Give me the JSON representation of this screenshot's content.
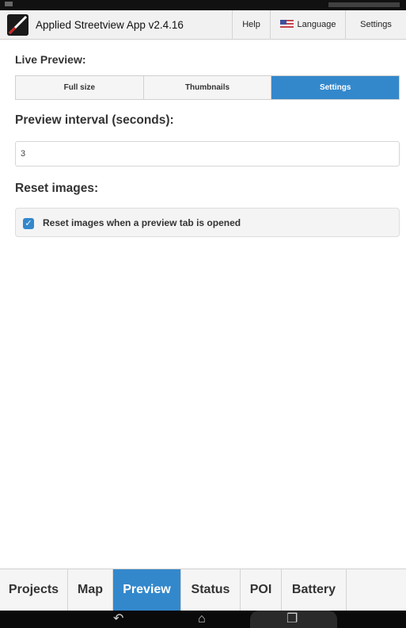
{
  "header": {
    "app_title": "Applied Streetview App v2.4.16",
    "help_label": "Help",
    "language_label": "Language",
    "settings_label": "Settings"
  },
  "live_preview": {
    "label": "Live Preview:",
    "tabs": [
      {
        "label": "Full size",
        "active": false
      },
      {
        "label": "Thumbnails",
        "active": false
      },
      {
        "label": "Settings",
        "active": true
      }
    ]
  },
  "preview_interval": {
    "label": "Preview interval (seconds):",
    "value": "3"
  },
  "reset_images": {
    "label": "Reset images:",
    "checkbox_label": "Reset images when a preview tab is opened",
    "checked": true
  },
  "bottom_nav": {
    "tabs": [
      {
        "label": "Projects",
        "active": false
      },
      {
        "label": "Map",
        "active": false
      },
      {
        "label": "Preview",
        "active": true
      },
      {
        "label": "Status",
        "active": false
      },
      {
        "label": "POI",
        "active": false
      },
      {
        "label": "Battery",
        "active": false
      }
    ]
  },
  "colors": {
    "accent": "#3388cc",
    "header_bg": "#f1f1f1",
    "system_bar": "#111111"
  },
  "icons": {
    "logo": "app-logo-icon",
    "flag": "us-flag-icon",
    "back": "back-arrow-icon",
    "home": "home-icon",
    "recents": "recents-icon"
  }
}
